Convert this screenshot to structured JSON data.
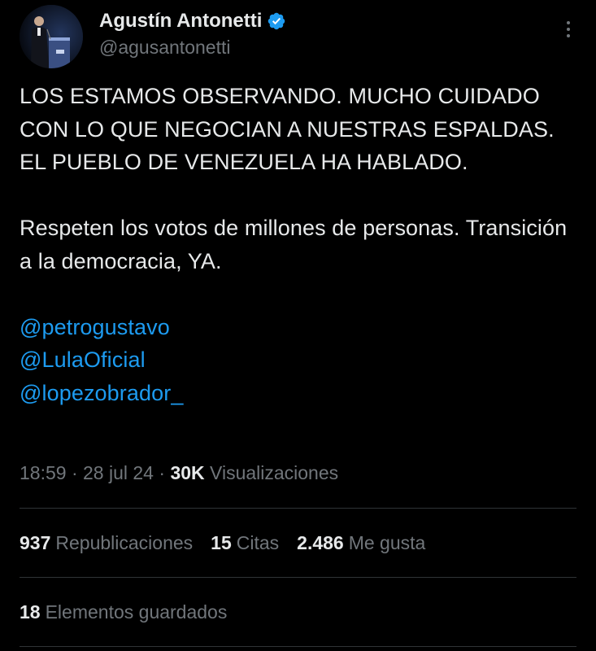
{
  "author": {
    "display_name": "Agustín Antonetti",
    "handle": "@agusantonetti",
    "verified_icon": "verified-badge-icon"
  },
  "menu": {
    "icon": "more-vertical-icon"
  },
  "tweet": {
    "paragraph_1": "LOS ESTAMOS OBSERVANDO. MUCHO CUIDADO CON LO QUE NEGOCIAN A NUESTRAS ESPALDAS. EL PUEBLO DE VENEZUELA HA HABLADO.",
    "paragraph_2": "Respeten los votos de millones de personas. Transición a la democracia, YA.",
    "mentions": [
      "@petrogustavo",
      "@LulaOficial",
      "@lopezobrador_"
    ]
  },
  "meta": {
    "time": "18:59",
    "separator": " · ",
    "date": "28 jul 24",
    "views_count": "30K",
    "views_label": "Visualizaciones"
  },
  "stats": {
    "retweets_count": "937",
    "retweets_label": "Republicaciones",
    "quotes_count": "15",
    "quotes_label": "Citas",
    "likes_count": "2.486",
    "likes_label": "Me gusta"
  },
  "bookmarks": {
    "count": "18",
    "label": "Elementos guardados"
  },
  "colors": {
    "background": "#000000",
    "text": "#e7e9ea",
    "secondary": "#71767b",
    "accent": "#1d9bf0",
    "divider": "#2f3336"
  }
}
